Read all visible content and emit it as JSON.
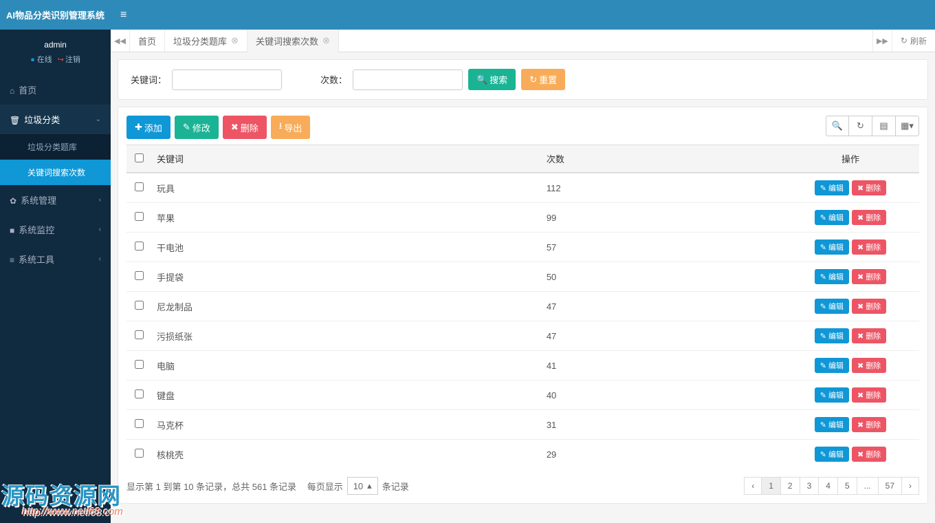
{
  "brand": "AI物品分类识别管理系统",
  "user": {
    "name": "admin",
    "online": "在线",
    "logout": "注销"
  },
  "sidebar": {
    "home": "首页",
    "garbage": "垃圾分类",
    "garbage_sub1": "垃圾分类题库",
    "garbage_sub2": "关键词搜索次数",
    "sysmgmt": "系统管理",
    "sysmon": "系统监控",
    "systool": "系统工具"
  },
  "tabs": {
    "home": "首页",
    "t1": "垃圾分类题库",
    "t2": "关键词搜索次数",
    "refresh": "刷新"
  },
  "search": {
    "keyword_label": "关键词：",
    "count_label": "次数：",
    "search_btn": "搜索",
    "reset_btn": "重置"
  },
  "toolbar": {
    "add": "添加",
    "edit": "修改",
    "del": "删除",
    "export": "导出"
  },
  "table": {
    "headers": {
      "keyword": "关键词",
      "count": "次数",
      "op": "操作"
    },
    "edit": "编辑",
    "del": "删除",
    "rows": [
      {
        "k": "玩具",
        "c": "112"
      },
      {
        "k": "苹果",
        "c": "99"
      },
      {
        "k": "干电池",
        "c": "57"
      },
      {
        "k": "手提袋",
        "c": "50"
      },
      {
        "k": "尼龙制品",
        "c": "47"
      },
      {
        "k": "污损纸张",
        "c": "47"
      },
      {
        "k": "电脑",
        "c": "41"
      },
      {
        "k": "键盘",
        "c": "40"
      },
      {
        "k": "马克杯",
        "c": "31"
      },
      {
        "k": "核桃壳",
        "c": "29"
      }
    ]
  },
  "footer": {
    "info_a": "显示第 1 到第 10 条记录，总共 561 条记录",
    "info_b": "每页显示",
    "pagesize": "10",
    "info_c": "条记录",
    "pages": [
      "‹",
      "1",
      "2",
      "3",
      "4",
      "5",
      "...",
      "57",
      "›"
    ]
  },
  "watermark": {
    "main": "源码资源网",
    "sub": "http://www.netl68.com"
  }
}
